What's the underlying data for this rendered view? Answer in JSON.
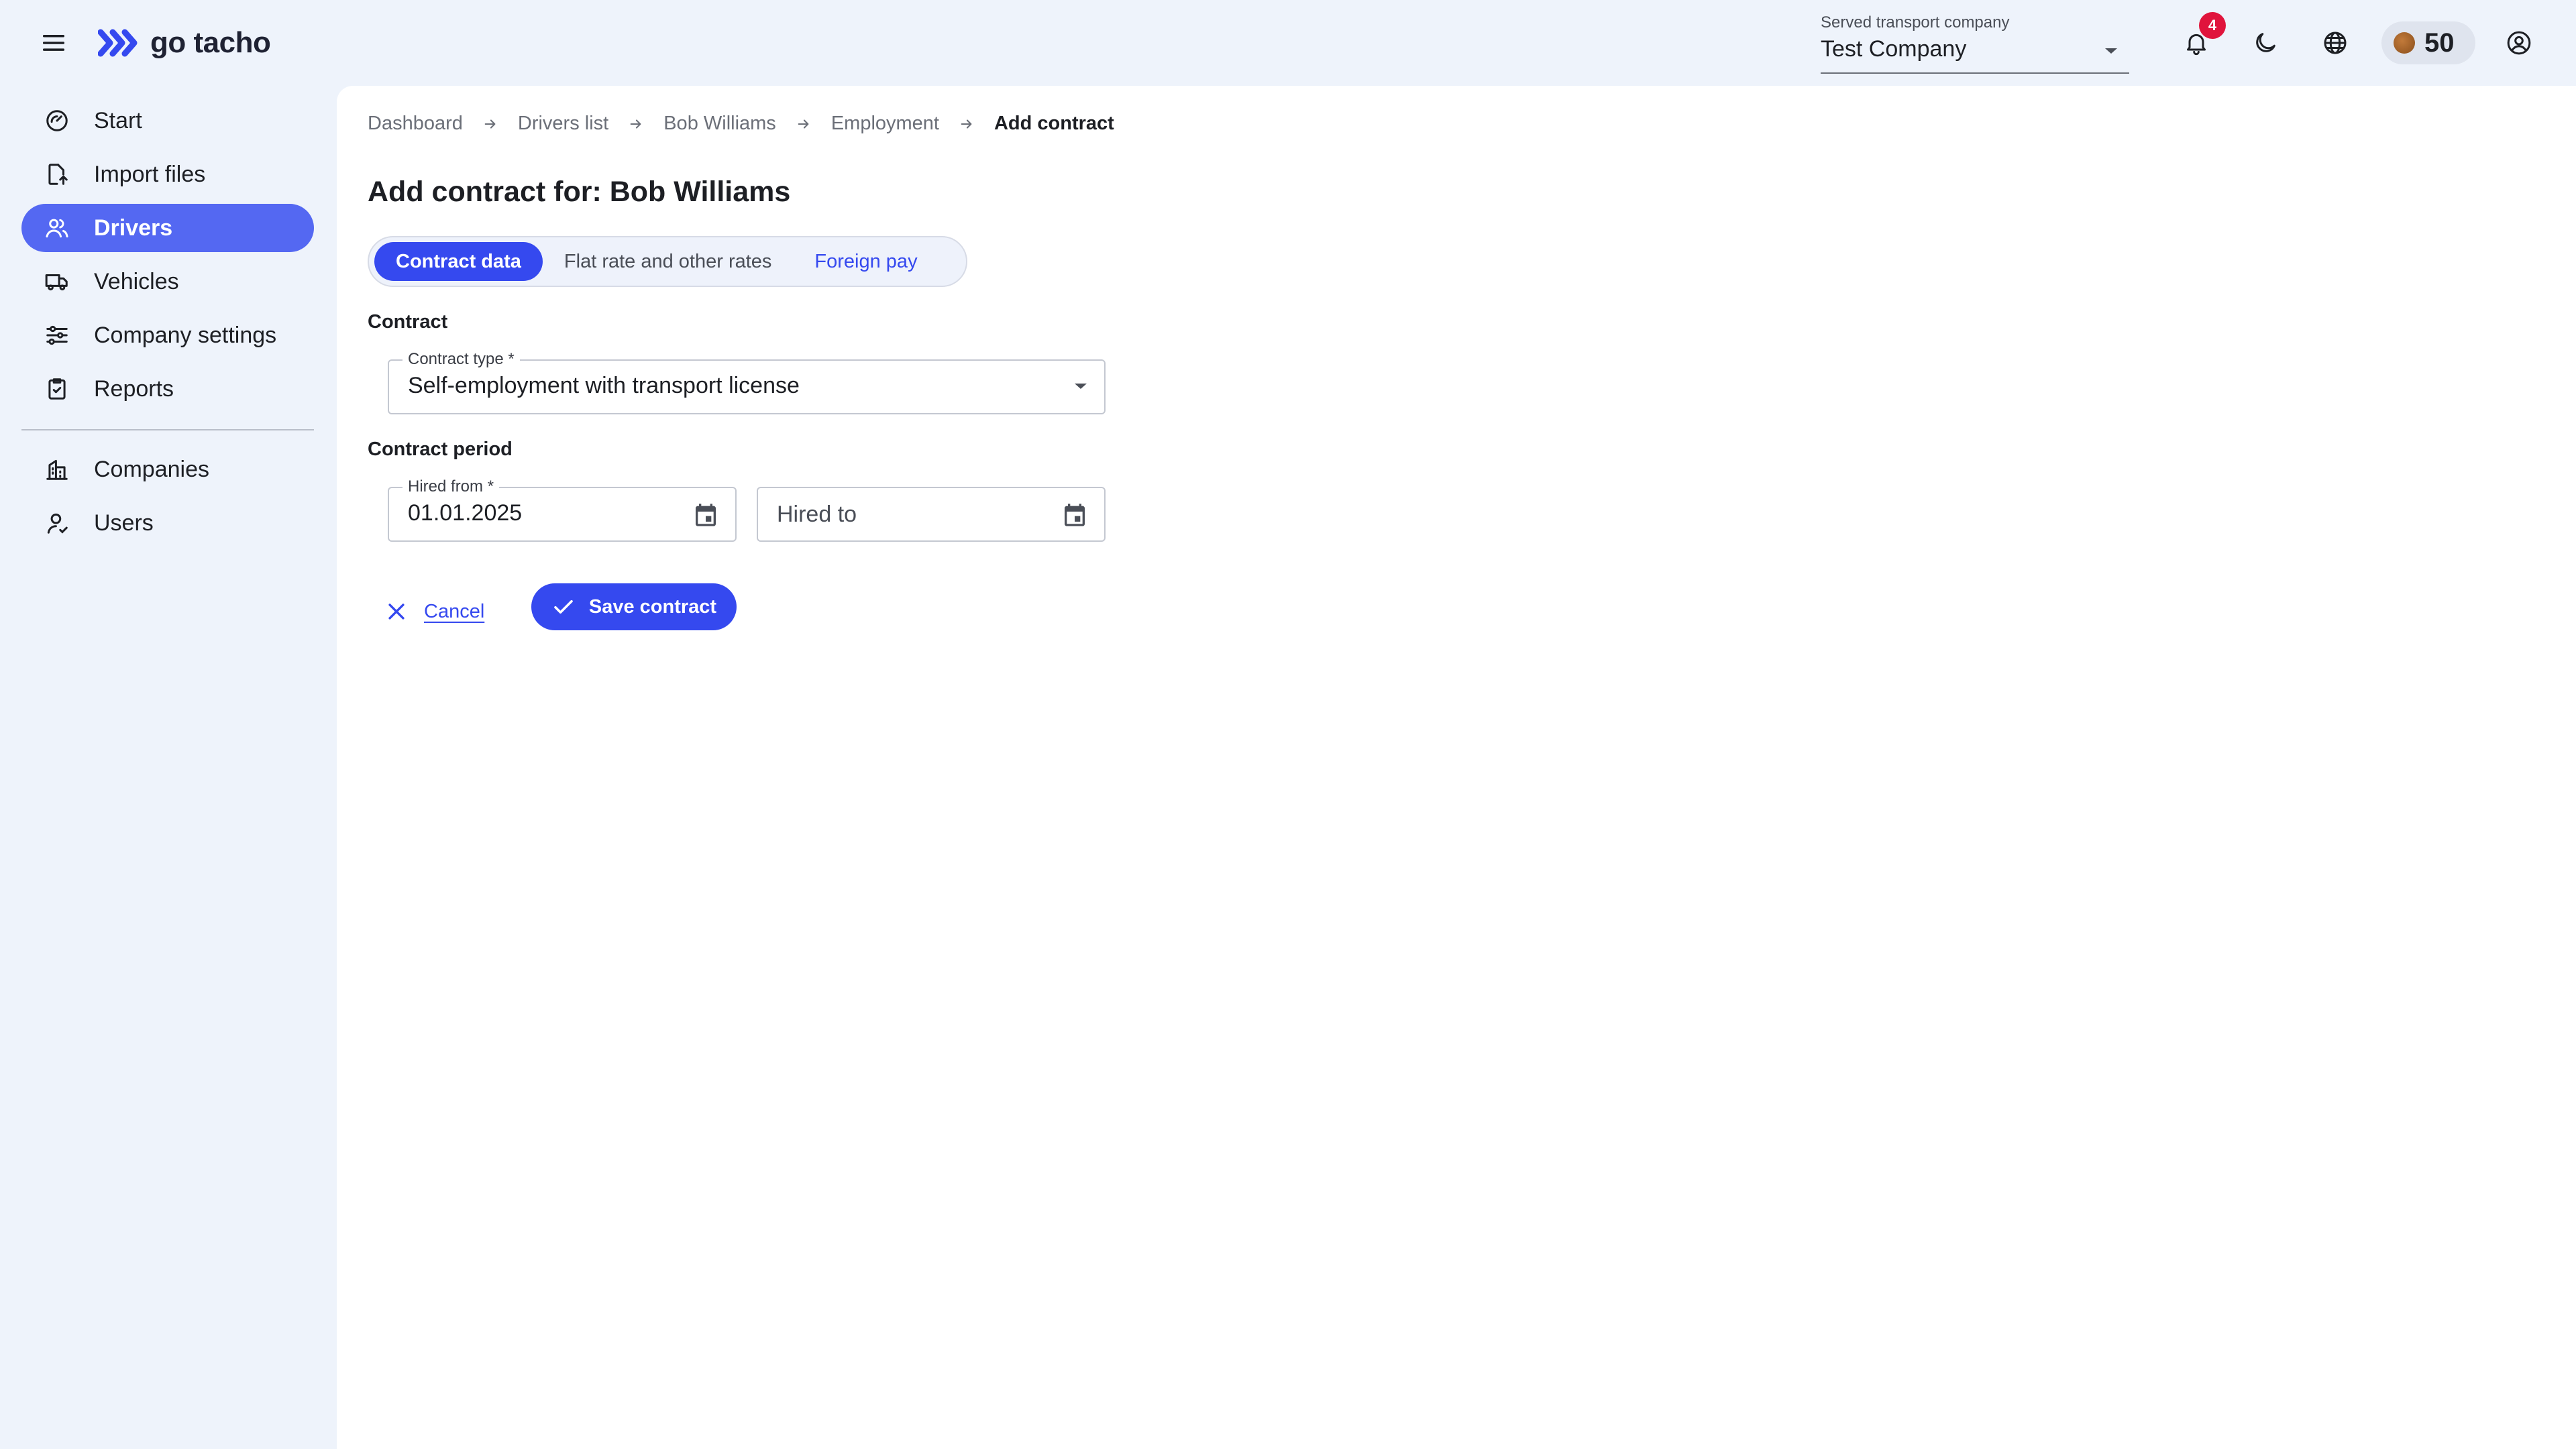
{
  "app": {
    "logo_text": "go tacho",
    "colors": {
      "accent": "#3549ef",
      "nav_active": "#5468f2",
      "badge": "#e0143c",
      "background": "#eef3fb"
    }
  },
  "header": {
    "company_select": {
      "label": "Served transport company",
      "value": "Test Company"
    },
    "notifications": {
      "count": "4",
      "icon": "bell-icon"
    },
    "theme_icon": "moon-icon",
    "language_icon": "globe-icon",
    "coins": {
      "value": "50"
    },
    "account_icon": "account-circle-icon"
  },
  "sidebar": {
    "items": [
      {
        "label": "Start",
        "icon": "speedometer-icon",
        "active": false
      },
      {
        "label": "Import files",
        "icon": "import-file-icon",
        "active": false
      },
      {
        "label": "Drivers",
        "icon": "people-icon",
        "active": true
      },
      {
        "label": "Vehicles",
        "icon": "truck-icon",
        "active": false
      },
      {
        "label": "Company settings",
        "icon": "sliders-icon",
        "active": false
      },
      {
        "label": "Reports",
        "icon": "clipboard-check-icon",
        "active": false
      }
    ],
    "secondary_items": [
      {
        "label": "Companies",
        "icon": "building-icon"
      },
      {
        "label": "Users",
        "icon": "user-icon"
      }
    ]
  },
  "breadcrumb": [
    "Dashboard",
    "Drivers list",
    "Bob Williams",
    "Employment",
    "Add contract"
  ],
  "page": {
    "title": "Add contract for: Bob Williams",
    "tabs": [
      {
        "label": "Contract data",
        "state": "active"
      },
      {
        "label": "Flat rate and other rates",
        "state": "default"
      },
      {
        "label": "Foreign pay",
        "state": "link"
      }
    ],
    "contract_section": {
      "title": "Contract",
      "contract_type": {
        "label": "Contract type *",
        "value": "Self-employment with transport license"
      }
    },
    "period_section": {
      "title": "Contract period",
      "hired_from": {
        "label": "Hired from *",
        "value": "01.01.2025"
      },
      "hired_to": {
        "placeholder": "Hired to"
      }
    },
    "actions": {
      "cancel_label": "Cancel",
      "save_label": "Save contract"
    }
  }
}
